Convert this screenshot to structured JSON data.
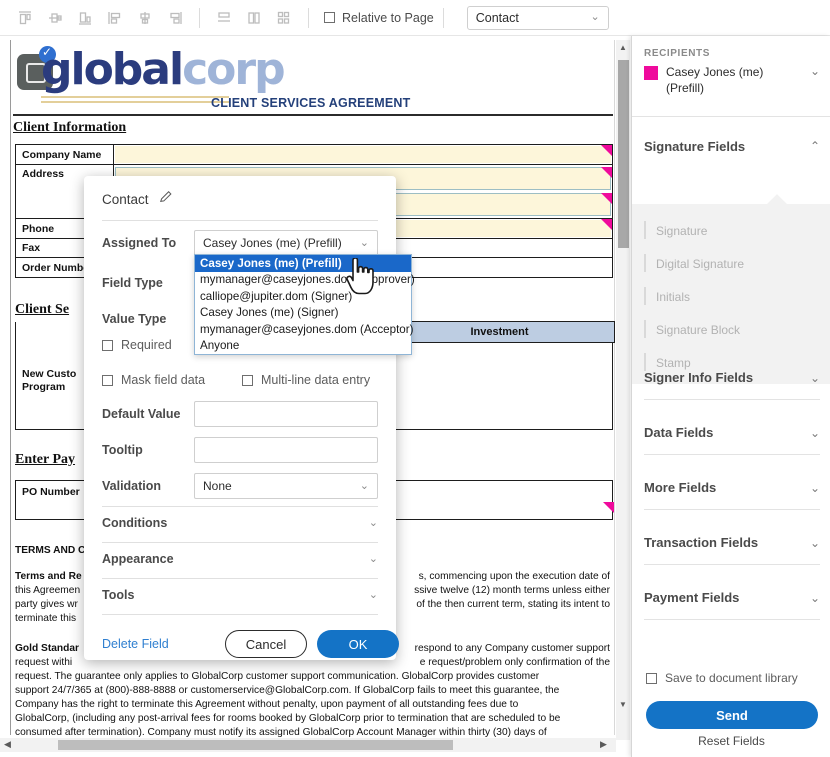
{
  "toolbar": {
    "align_icons": [
      {
        "name": "align-top-icon"
      },
      {
        "name": "align-vertical-center-icon"
      },
      {
        "name": "align-bottom-icon"
      },
      {
        "name": "align-left-icon"
      },
      {
        "name": "align-horizontal-center-icon"
      },
      {
        "name": "align-right-icon"
      },
      {
        "name": "distribute-vertical-icon"
      },
      {
        "name": "match-width-icon"
      },
      {
        "name": "match-size-icon"
      }
    ],
    "relative_to_page_label": "Relative to Page",
    "relative_to_page_checked": false,
    "field_select_value": "Contact"
  },
  "document": {
    "logo": {
      "primary": "global",
      "secondary": "corp"
    },
    "agreement_title": "CLIENT SERVICES AGREEMENT",
    "section_client_information": "Client Information",
    "client_rows": [
      {
        "label": "Company Name"
      },
      {
        "label": "Address"
      },
      {
        "label": "Phone"
      },
      {
        "label": "Fax"
      },
      {
        "label": "Order Number"
      }
    ],
    "section_client_services": "Client Se",
    "investment_header": "Investment",
    "program_label_line1": "New Custo",
    "program_label_line2": "Program",
    "section_enter_payment": "Enter Pay",
    "po_number_label": "PO Number",
    "terms_heading": "TERMS AND C",
    "terms_paragraph_lead": "Terms and Re",
    "terms_paragraph_parts": [
      "s, commencing upon the execution date of",
      "ssive twelve (12) month terms unless either",
      "of the then current term, stating its intent to"
    ],
    "terms_line_starts": [
      "this Agreemen",
      "party gives wr",
      "terminate this"
    ],
    "gold_standard_lead": "Gold Standar",
    "gold_standard_parts": [
      "respond to any Company customer support",
      "e request/problem only confirmation of the"
    ],
    "gold_standard_line_starts": [
      "request withi"
    ],
    "gold_standard_rest": [
      "request. The guarantee only applies to GlobalCorp customer support communication. GlobalCorp provides customer",
      "support 24/7/365 at (800)-888-8888 or customerservice@GlobalCorp.com.  If GlobalCorp fails to meet this guarantee, the",
      "Company has the right to terminate this Agreement without penalty, upon payment of all outstanding fees due to",
      "GlobalCorp, (including any post-arrival fees for rooms booked by GlobalCorp prior to termination that are scheduled to be",
      "consumed after termination).  Company must notify its assigned GlobalCorp Account Manager within thirty (30) days of"
    ]
  },
  "dialog": {
    "title": "Contact",
    "assigned_to_label": "Assigned To",
    "assigned_to_value": "Casey Jones (me) (Prefill)",
    "field_type_label": "Field Type",
    "value_type_label": "Value Type",
    "required_label": "Required",
    "required_checked": false,
    "mask_field_label": "Mask field data",
    "mask_field_checked": false,
    "multiline_label": "Multi-line data entry",
    "multiline_checked": false,
    "default_value_label": "Default Value",
    "default_value": "",
    "tooltip_label": "Tooltip",
    "tooltip_value": "",
    "validation_label": "Validation",
    "validation_value": "None",
    "conditions_label": "Conditions",
    "appearance_label": "Appearance",
    "tools_label": "Tools",
    "delete_field_label": "Delete Field",
    "cancel_label": "Cancel",
    "ok_label": "OK"
  },
  "dropdown": {
    "options": [
      "Casey Jones (me) (Prefill)",
      "mymanager@caseyjones.dom (Approver)",
      "calliope@jupiter.dom (Signer)",
      "Casey Jones (me) (Signer)",
      "mymanager@caseyjones.dom (Acceptor)",
      "Anyone"
    ],
    "selected_index": 0
  },
  "rail": {
    "recipients_label": "RECIPIENTS",
    "recipient_name": "Casey Jones (me) (Prefill)",
    "recipient_color": "#ef0a9c",
    "sections": [
      {
        "label": "Signature Fields",
        "expanded": true
      },
      {
        "label": "Signer Info Fields",
        "expanded": false
      },
      {
        "label": "Data Fields",
        "expanded": false
      },
      {
        "label": "More Fields",
        "expanded": false
      },
      {
        "label": "Transaction Fields",
        "expanded": false
      },
      {
        "label": "Payment Fields",
        "expanded": false
      }
    ],
    "signature_fields": [
      "Signature",
      "Digital Signature",
      "Initials",
      "Signature Block",
      "Stamp"
    ],
    "save_library_label": "Save to document library",
    "save_library_checked": false,
    "send_label": "Send",
    "reset_label": "Reset Fields"
  }
}
